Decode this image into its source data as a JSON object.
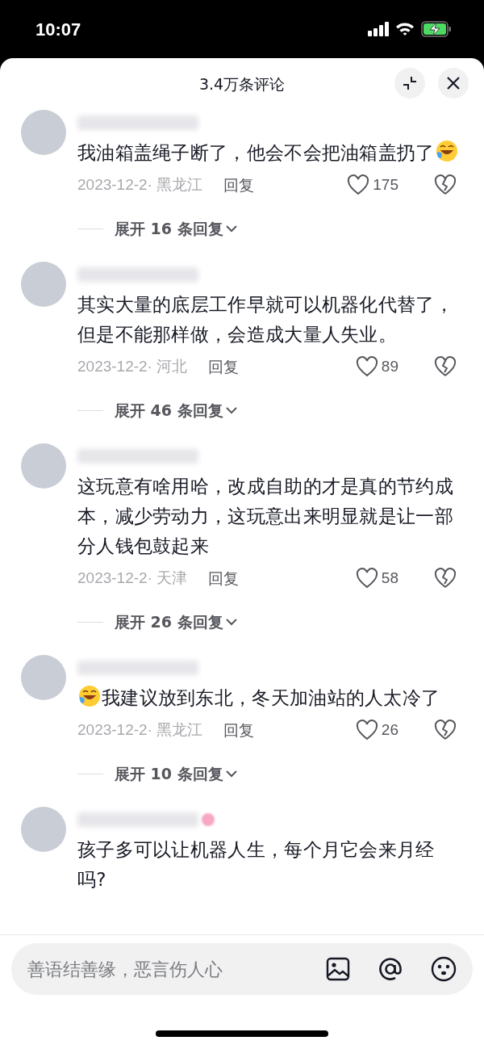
{
  "status_bar": {
    "time": "10:07"
  },
  "header": {
    "title": "3.4万条评论"
  },
  "comments": [
    {
      "body": [
        {
          "kind": "text",
          "text": "我油箱盖绳子断了，他会不会把油箱盖扔了"
        },
        {
          "kind": "emoji"
        }
      ],
      "date": "2023-12-2· 黑龙江",
      "reply": "回复",
      "likes": "175",
      "expand": "展开 16 条回复",
      "name_tag": false
    },
    {
      "body": [
        {
          "kind": "text",
          "text": "其实大量的底层工作早就可以机器化代替了，但是不能那样做，会造成大量人失业。"
        }
      ],
      "date": "2023-12-2· 河北",
      "reply": "回复",
      "likes": "89",
      "expand": "展开 46 条回复",
      "name_tag": false
    },
    {
      "body": [
        {
          "kind": "text",
          "text": "这玩意有啥用哈，改成自助的才是真的节约成本，减少劳动力，这玩意出来明显就是让一部分人钱包鼓起来"
        }
      ],
      "date": "2023-12-2· 天津",
      "reply": "回复",
      "likes": "58",
      "expand": "展开 26 条回复",
      "name_tag": false
    },
    {
      "body": [
        {
          "kind": "emoji"
        },
        {
          "kind": "text",
          "text": "我建议放到东北，冬天加油站的人太冷了"
        }
      ],
      "date": "2023-12-2· 黑龙江",
      "reply": "回复",
      "likes": "26",
      "expand": "展开 10 条回复",
      "name_tag": false
    },
    {
      "body": [
        {
          "kind": "text",
          "text": "孩子多可以让机器人生，每个月它会来月经吗?"
        }
      ],
      "name_tag": true
    }
  ],
  "input": {
    "placeholder": "善语结善缘，恶言伤人心"
  }
}
